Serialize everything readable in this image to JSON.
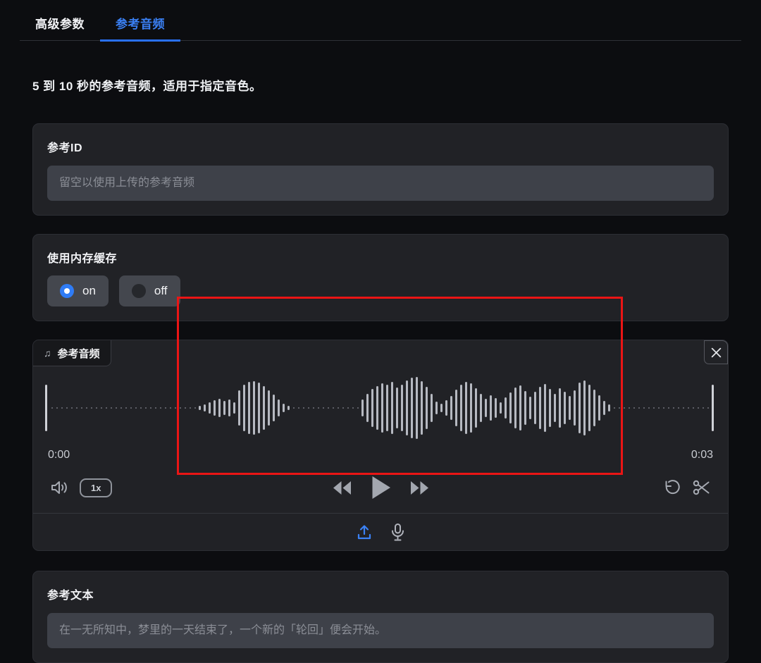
{
  "tabs": [
    {
      "label": "高级参数",
      "active": false
    },
    {
      "label": "参考音频",
      "active": true
    }
  ],
  "description": "5 到 10 秒的参考音频，适用于指定音色。",
  "reference_id": {
    "label": "参考ID",
    "value": "",
    "placeholder": "留空以使用上传的参考音频"
  },
  "memory_cache": {
    "label": "使用内存缓存",
    "options": [
      {
        "label": "on",
        "selected": true
      },
      {
        "label": "off",
        "selected": false
      }
    ]
  },
  "player": {
    "badge_icon": "music-note",
    "badge_label": "参考音频",
    "current_time": "0:00",
    "total_time": "0:03",
    "speed_label": "1x",
    "icons": [
      "close-icon",
      "volume-icon",
      "rewind-icon",
      "play-icon",
      "fast-forward-icon",
      "reset-icon",
      "scissors-icon",
      "upload-icon",
      "microphone-icon"
    ],
    "waveform": {
      "bar_color": "#b6b9c1",
      "dot_color": "#6f727a",
      "marker_color": "#d0d2d8",
      "slots": [
        0,
        0,
        0,
        0,
        0,
        0,
        0,
        0,
        0,
        0,
        0,
        0,
        0,
        0,
        0,
        0,
        0,
        0,
        0,
        0,
        0,
        0,
        0,
        0,
        0,
        0,
        0,
        0,
        0,
        0,
        6,
        10,
        16,
        22,
        26,
        20,
        24,
        16,
        50,
        66,
        74,
        76,
        72,
        62,
        50,
        38,
        24,
        12,
        6,
        0,
        0,
        0,
        0,
        0,
        0,
        0,
        0,
        0,
        0,
        0,
        0,
        0,
        0,
        24,
        40,
        54,
        62,
        70,
        66,
        74,
        58,
        66,
        78,
        86,
        88,
        76,
        60,
        40,
        18,
        12,
        22,
        34,
        52,
        66,
        74,
        70,
        56,
        40,
        26,
        36,
        28,
        16,
        30,
        44,
        58,
        64,
        48,
        32,
        46,
        60,
        68,
        54,
        40,
        56,
        46,
        34,
        50,
        72,
        78,
        66,
        52,
        36,
        20,
        10,
        0,
        0,
        0,
        0,
        0,
        0,
        0,
        0,
        0,
        0,
        0,
        0,
        0,
        0,
        0,
        0,
        0,
        0,
        0,
        0
      ]
    }
  },
  "reference_text": {
    "label": "参考文本",
    "value": "",
    "placeholder": "在一无所知中，梦里的一天结束了，一个新的「轮回」便会开始。"
  },
  "colors": {
    "accent_blue": "#3a7ff2",
    "annotation_red": "#ea1515"
  }
}
